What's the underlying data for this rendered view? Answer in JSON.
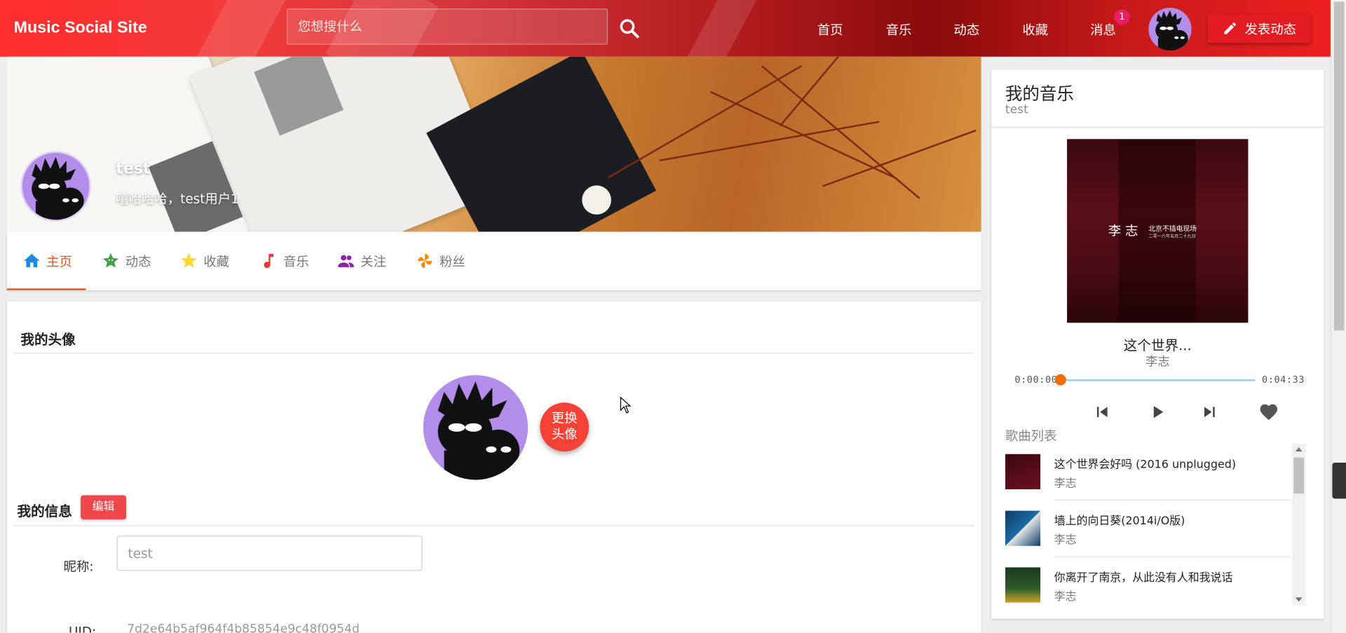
{
  "header": {
    "brand": "Music Social Site",
    "search_placeholder": "您想搜什么",
    "nav": [
      "首页",
      "音乐",
      "动态",
      "收藏",
      "消息"
    ],
    "message_badge": "1",
    "post_label": "发表动态"
  },
  "profile": {
    "name": "test",
    "signature": "嘻哈哈哈，test用户1"
  },
  "tabs": [
    {
      "label": "主页",
      "icon": "home-icon",
      "color": "#1e88e5"
    },
    {
      "label": "动态",
      "icon": "star-face-icon",
      "color": "#43a047"
    },
    {
      "label": "收藏",
      "icon": "star-icon",
      "color": "#fdd835"
    },
    {
      "label": "音乐",
      "icon": "music-note-icon",
      "color": "#e53935"
    },
    {
      "label": "关注",
      "icon": "people-icon",
      "color": "#8e24aa"
    },
    {
      "label": "粉丝",
      "icon": "pinwheel-icon",
      "color": "#fb8c00"
    }
  ],
  "avatar_section": {
    "title": "我的头像",
    "change_label_1": "更换",
    "change_label_2": "头像"
  },
  "info_section": {
    "title": "我的信息",
    "edit_label": "编辑",
    "nickname_label": "昵称:",
    "nickname_value": "test",
    "uid_label": "UID:",
    "uid_value": "7d2e64b5af964f4b85854e9c48f0954d"
  },
  "player": {
    "title": "我的音乐",
    "owner": "test",
    "cover_artist": "李 志",
    "cover_caption_1": "北京不插电现场",
    "cover_caption_2": "二零一六年五月二十九日",
    "current_title": "这个世界...",
    "current_artist": "李志",
    "time_current": "0:00:00",
    "time_total": "0:04:33",
    "progress": 0.0,
    "playlist_label": "歌曲列表",
    "songs": [
      {
        "title": "这个世界会好吗 (2016 unplugged)",
        "artist": "李志"
      },
      {
        "title": "墙上的向日葵(2014i/O版)",
        "artist": "李志"
      },
      {
        "title": "你离开了南京，从此没有人和我说话",
        "artist": "李志"
      }
    ]
  },
  "colors": {
    "accent": "#e8541f",
    "header_red": "#e31b23",
    "avatar_purple": "#b28eea",
    "progress_track": "#90caf9",
    "progress_knob": "#ef6c00"
  }
}
